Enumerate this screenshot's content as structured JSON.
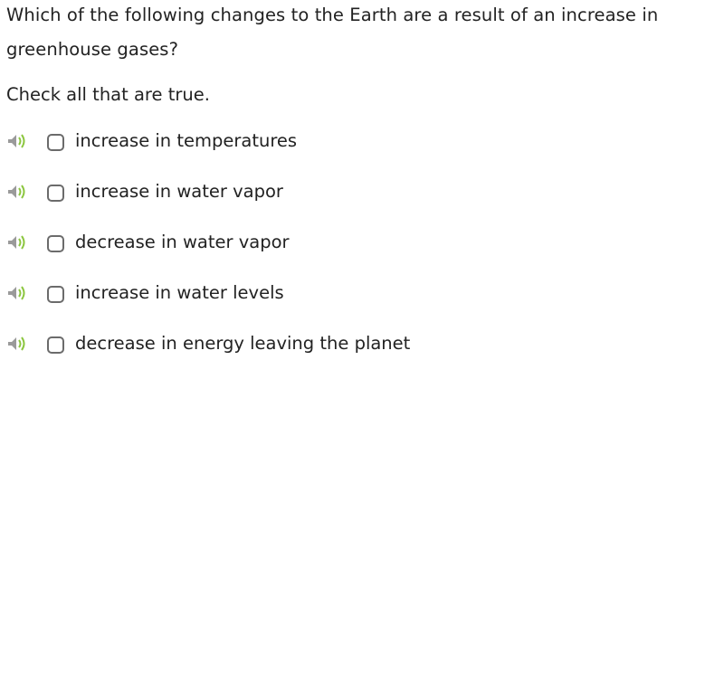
{
  "question": {
    "text": "Which of the following changes to the Earth are a result of an increase in greenhouse gases?",
    "instruction": "Check all that are true."
  },
  "options": [
    {
      "label": "increase in temperatures",
      "checked": false,
      "icon": "speaker-icon"
    },
    {
      "label": "increase in water vapor",
      "checked": false,
      "icon": "speaker-icon"
    },
    {
      "label": "decrease in water vapor",
      "checked": false,
      "icon": "speaker-icon"
    },
    {
      "label": "increase in water levels",
      "checked": false,
      "icon": "speaker-icon"
    },
    {
      "label": "decrease in energy leaving the planet",
      "checked": false,
      "icon": "speaker-icon"
    }
  ],
  "colors": {
    "speaker_body": "#9a9a9a",
    "speaker_waves": "#8cc63f",
    "checkbox_border": "#6b6b6b",
    "text": "#222222"
  }
}
